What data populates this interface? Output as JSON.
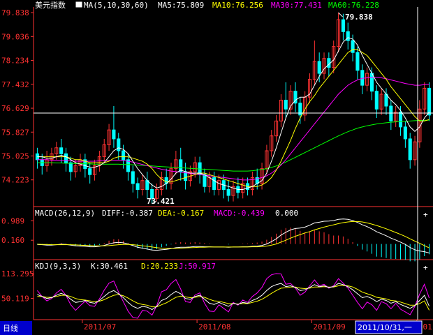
{
  "chart_data": {
    "type": "candlestick",
    "title": "美元指数",
    "colors": {
      "up": "#ff3232",
      "down": "#00ffff",
      "ma5": "#ffffff",
      "ma10": "#ffff00",
      "ma30": "#ff00ff",
      "ma60": "#00ff00",
      "grid": "#800000",
      "axis_text": "#ff3232",
      "price_text": "#ff5555"
    },
    "price_panel": {
      "ma_header": "MA(5,10,30,60)",
      "ma5_label": "MA5:75.809",
      "ma10_label": "MA10:76.256",
      "ma30_label": "MA30:77.431",
      "ma60_label": "MA60:76.228",
      "yticks": [
        "79.838",
        "79.036",
        "78.234",
        "77.432",
        "76.629",
        "75.827",
        "75.025",
        "74.223"
      ],
      "ylim": [
        73.42,
        79.84
      ],
      "high_label": "79.838",
      "low_label": "73.421",
      "cursor_price": 76.629
    },
    "macd_panel": {
      "header": "MACD(26,12,9)",
      "diff": "DIFF:-0.387",
      "dea": "DEA:-0.167",
      "macd": "MACD:-0.439",
      "extra": "0.000",
      "yticks": [
        "0.989",
        "0.160"
      ]
    },
    "kdj_panel": {
      "header": "KDJ(9,3,3)",
      "k": "K:30.461",
      "d": "D:20.233",
      "j": "J:50.917",
      "yticks": [
        "113.295",
        "50.119"
      ]
    },
    "x_axis": {
      "period_tab": "日线",
      "months": [
        "2011/07",
        "2011/08",
        "2011/09",
        "2011/1"
      ],
      "cursor_date": "2011/10/31,一"
    },
    "candles": [
      [
        75.1,
        74.9,
        75.3,
        74.6
      ],
      [
        74.9,
        74.7,
        75.1,
        74.4
      ],
      [
        74.7,
        74.9,
        75.2,
        74.5
      ],
      [
        74.9,
        75.1,
        75.3,
        74.7
      ],
      [
        75.1,
        75.3,
        75.5,
        74.9
      ],
      [
        75.3,
        75.1,
        75.6,
        74.8
      ],
      [
        75.1,
        74.8,
        75.3,
        74.5
      ],
      [
        74.8,
        74.5,
        75.0,
        74.2
      ],
      [
        74.5,
        74.7,
        74.9,
        74.3
      ],
      [
        74.7,
        74.9,
        75.1,
        74.5
      ],
      [
        74.9,
        74.6,
        75.1,
        74.3
      ],
      [
        74.6,
        74.4,
        74.8,
        74.1
      ],
      [
        74.4,
        74.7,
        74.9,
        74.2
      ],
      [
        74.7,
        75.0,
        75.2,
        74.5
      ],
      [
        75.0,
        75.4,
        75.6,
        74.8
      ],
      [
        75.4,
        75.9,
        76.1,
        75.2
      ],
      [
        75.9,
        75.6,
        76.7,
        75.3
      ],
      [
        75.6,
        75.2,
        75.8,
        74.9
      ],
      [
        75.2,
        74.9,
        75.4,
        74.6
      ],
      [
        74.9,
        74.5,
        75.1,
        74.2
      ],
      [
        74.5,
        74.1,
        74.7,
        73.8
      ],
      [
        74.1,
        73.9,
        74.3,
        73.6
      ],
      [
        73.9,
        74.2,
        74.4,
        73.7
      ],
      [
        74.2,
        73.9,
        74.5,
        73.6
      ],
      [
        73.9,
        73.6,
        74.1,
        73.42
      ],
      [
        73.6,
        73.9,
        74.1,
        73.5
      ],
      [
        73.9,
        74.3,
        74.5,
        73.7
      ],
      [
        74.3,
        74.1,
        74.6,
        73.9
      ],
      [
        74.1,
        74.6,
        74.8,
        73.9
      ],
      [
        74.6,
        74.9,
        75.2,
        74.4
      ],
      [
        74.9,
        74.5,
        75.3,
        74.2
      ],
      [
        74.5,
        74.2,
        74.8,
        73.9
      ],
      [
        74.2,
        74.5,
        74.7,
        74.0
      ],
      [
        74.5,
        74.8,
        75.0,
        74.3
      ],
      [
        74.8,
        74.4,
        75.0,
        74.1
      ],
      [
        74.4,
        74.0,
        74.6,
        73.8
      ],
      [
        74.0,
        74.3,
        74.5,
        73.8
      ],
      [
        74.3,
        73.9,
        74.5,
        73.7
      ],
      [
        73.9,
        74.2,
        74.4,
        73.7
      ],
      [
        74.2,
        73.9,
        74.4,
        73.6
      ],
      [
        73.9,
        73.7,
        74.2,
        73.5
      ],
      [
        73.7,
        74.0,
        74.2,
        73.5
      ],
      [
        74.0,
        73.8,
        74.3,
        73.6
      ],
      [
        73.8,
        74.1,
        74.3,
        73.6
      ],
      [
        74.1,
        73.9,
        74.3,
        73.7
      ],
      [
        73.9,
        74.3,
        74.5,
        73.7
      ],
      [
        74.3,
        74.1,
        74.6,
        73.9
      ],
      [
        74.1,
        74.6,
        74.8,
        73.9
      ],
      [
        74.6,
        75.2,
        75.4,
        74.4
      ],
      [
        75.2,
        75.7,
        75.9,
        75.0
      ],
      [
        75.7,
        76.2,
        76.4,
        75.5
      ],
      [
        76.2,
        76.9,
        77.1,
        76.0
      ],
      [
        76.9,
        76.6,
        77.5,
        76.3
      ],
      [
        76.6,
        77.2,
        77.4,
        76.4
      ],
      [
        77.2,
        76.8,
        77.5,
        76.5
      ],
      [
        76.8,
        76.4,
        77.0,
        76.1
      ],
      [
        76.4,
        77.0,
        77.2,
        76.2
      ],
      [
        77.0,
        77.6,
        77.8,
        76.8
      ],
      [
        77.6,
        78.2,
        78.9,
        77.4
      ],
      [
        78.2,
        77.8,
        78.5,
        77.5
      ],
      [
        77.8,
        78.3,
        78.5,
        77.6
      ],
      [
        78.3,
        78.0,
        78.5,
        77.7
      ],
      [
        78.0,
        78.7,
        78.9,
        77.8
      ],
      [
        78.7,
        79.6,
        79.838,
        78.5
      ],
      [
        79.6,
        79.2,
        79.8,
        78.9
      ],
      [
        79.2,
        78.9,
        79.5,
        78.6
      ],
      [
        78.9,
        78.5,
        79.1,
        78.2
      ],
      [
        78.5,
        77.9,
        78.7,
        77.6
      ],
      [
        77.9,
        77.4,
        78.1,
        77.1
      ],
      [
        77.4,
        77.8,
        78.0,
        77.2
      ],
      [
        77.8,
        77.2,
        78.0,
        76.9
      ],
      [
        77.2,
        76.6,
        77.4,
        76.3
      ],
      [
        76.6,
        77.1,
        77.3,
        76.4
      ],
      [
        77.1,
        76.7,
        77.3,
        76.4
      ],
      [
        76.7,
        76.2,
        76.9,
        75.9
      ],
      [
        76.2,
        76.5,
        76.7,
        76.0
      ],
      [
        76.5,
        76.0,
        76.7,
        75.7
      ],
      [
        76.0,
        75.6,
        76.2,
        75.3
      ],
      [
        75.6,
        74.9,
        75.8,
        74.6
      ],
      [
        74.9,
        75.5,
        75.7,
        74.7
      ],
      [
        75.5,
        76.6,
        76.9,
        75.3
      ],
      [
        76.6,
        77.3,
        77.5,
        76.4
      ],
      [
        77.3,
        76.4,
        77.5,
        76.2
      ]
    ],
    "ma5": [
      75.0,
      75.0,
      74.95,
      74.95,
      75.0,
      75.05,
      75.0,
      74.9,
      74.8,
      74.75,
      74.7,
      74.65,
      74.65,
      74.7,
      74.8,
      75.0,
      75.2,
      75.3,
      75.25,
      75.1,
      74.85,
      74.6,
      74.4,
      74.2,
      74.05,
      73.95,
      74.0,
      74.1,
      74.25,
      74.45,
      74.55,
      74.5,
      74.45,
      74.45,
      74.45,
      74.4,
      74.3,
      74.2,
      74.1,
      74.05,
      74.0,
      73.95,
      73.9,
      73.9,
      73.95,
      74.0,
      74.1,
      74.2,
      74.45,
      74.85,
      75.3,
      75.8,
      76.3,
      76.7,
      76.9,
      77.0,
      77.0,
      77.1,
      77.4,
      77.7,
      77.95,
      78.1,
      78.25,
      78.55,
      78.85,
      79.0,
      78.95,
      78.75,
      78.4,
      78.1,
      77.8,
      77.5,
      77.3,
      77.1,
      76.9,
      76.75,
      76.55,
      76.3,
      76.0,
      75.85,
      76.0,
      76.3,
      76.5
    ],
    "ma10": [
      75.0,
      75.0,
      75.0,
      75.0,
      75.0,
      75.0,
      75.0,
      74.95,
      74.9,
      74.9,
      74.85,
      74.8,
      74.8,
      74.8,
      74.8,
      74.85,
      74.95,
      75.0,
      75.0,
      75.0,
      74.95,
      74.9,
      74.85,
      74.75,
      74.6,
      74.4,
      74.25,
      74.15,
      74.15,
      74.2,
      74.25,
      74.3,
      74.35,
      74.4,
      74.45,
      74.45,
      74.4,
      74.35,
      74.3,
      74.25,
      74.2,
      74.15,
      74.1,
      74.05,
      74.0,
      74.0,
      74.0,
      74.05,
      74.15,
      74.3,
      74.55,
      74.85,
      75.2,
      75.55,
      75.95,
      76.3,
      76.6,
      76.85,
      77.05,
      77.3,
      77.5,
      77.7,
      77.9,
      78.1,
      78.3,
      78.5,
      78.6,
      78.6,
      78.5,
      78.4,
      78.2,
      78.0,
      77.8,
      77.6,
      77.35,
      77.15,
      76.95,
      76.75,
      76.55,
      76.35,
      76.2,
      76.2,
      76.25
    ],
    "ma30": [
      74.9,
      74.9,
      74.9,
      74.88,
      74.88,
      74.88,
      74.87,
      74.86,
      74.85,
      74.85,
      74.85,
      74.85,
      74.85,
      74.86,
      74.87,
      74.88,
      74.88,
      74.88,
      74.87,
      74.85,
      74.82,
      74.78,
      74.74,
      74.7,
      74.66,
      74.62,
      74.58,
      74.55,
      74.52,
      74.5,
      74.48,
      74.46,
      74.44,
      74.42,
      74.4,
      74.38,
      74.36,
      74.34,
      74.32,
      74.3,
      74.28,
      74.26,
      74.24,
      74.22,
      74.22,
      74.23,
      74.26,
      74.3,
      74.36,
      74.45,
      74.57,
      74.72,
      74.9,
      75.1,
      75.3,
      75.5,
      75.7,
      75.9,
      76.1,
      76.3,
      76.5,
      76.7,
      76.9,
      77.1,
      77.25,
      77.4,
      77.5,
      77.58,
      77.63,
      77.65,
      77.66,
      77.66,
      77.65,
      77.62,
      77.58,
      77.54,
      77.5,
      77.46,
      77.43,
      77.4,
      77.4,
      77.42,
      77.43
    ],
    "ma60": [
      74.8,
      74.8,
      74.8,
      74.8,
      74.79,
      74.79,
      74.78,
      74.78,
      74.77,
      74.77,
      74.76,
      74.76,
      74.75,
      74.75,
      74.75,
      74.75,
      74.75,
      74.75,
      74.74,
      74.74,
      74.73,
      74.72,
      74.71,
      74.7,
      74.69,
      74.68,
      74.67,
      74.66,
      74.65,
      74.64,
      74.63,
      74.62,
      74.61,
      74.6,
      74.59,
      74.58,
      74.57,
      74.56,
      74.55,
      74.54,
      74.53,
      74.52,
      74.52,
      74.52,
      74.52,
      74.53,
      74.55,
      74.57,
      74.6,
      74.64,
      74.69,
      74.75,
      74.82,
      74.9,
      74.98,
      75.06,
      75.14,
      75.22,
      75.3,
      75.38,
      75.46,
      75.54,
      75.62,
      75.7,
      75.77,
      75.84,
      75.9,
      75.96,
      76.0,
      76.04,
      76.07,
      76.1,
      76.12,
      76.14,
      76.16,
      76.17,
      76.18,
      76.19,
      76.2,
      76.21,
      76.22,
      76.225,
      76.228
    ],
    "macd_diff": [
      -0.02,
      -0.03,
      -0.05,
      -0.05,
      -0.03,
      -0.01,
      -0.02,
      -0.05,
      -0.08,
      -0.09,
      -0.1,
      -0.12,
      -0.12,
      -0.1,
      -0.06,
      0.0,
      0.05,
      0.07,
      0.05,
      0.0,
      -0.07,
      -0.14,
      -0.18,
      -0.22,
      -0.26,
      -0.27,
      -0.25,
      -0.23,
      -0.2,
      -0.16,
      -0.14,
      -0.14,
      -0.13,
      -0.11,
      -0.11,
      -0.12,
      -0.12,
      -0.13,
      -0.13,
      -0.13,
      -0.14,
      -0.13,
      -0.13,
      -0.12,
      -0.12,
      -0.1,
      -0.09,
      -0.06,
      0.0,
      0.1,
      0.22,
      0.38,
      0.5,
      0.6,
      0.66,
      0.68,
      0.72,
      0.8,
      0.9,
      0.93,
      0.97,
      0.98,
      1.0,
      1.05,
      1.07,
      1.05,
      1.0,
      0.92,
      0.82,
      0.74,
      0.64,
      0.52,
      0.44,
      0.35,
      0.25,
      0.17,
      0.08,
      -0.02,
      -0.15,
      -0.25,
      -0.3,
      -0.33,
      -0.387
    ],
    "macd_dea": [
      -0.01,
      -0.02,
      -0.02,
      -0.03,
      -0.03,
      -0.03,
      -0.03,
      -0.03,
      -0.04,
      -0.05,
      -0.06,
      -0.07,
      -0.08,
      -0.08,
      -0.08,
      -0.07,
      -0.05,
      -0.03,
      -0.02,
      -0.02,
      -0.03,
      -0.05,
      -0.08,
      -0.1,
      -0.13,
      -0.16,
      -0.18,
      -0.19,
      -0.19,
      -0.19,
      -0.18,
      -0.17,
      -0.16,
      -0.15,
      -0.14,
      -0.14,
      -0.13,
      -0.13,
      -0.13,
      -0.13,
      -0.13,
      -0.13,
      -0.13,
      -0.13,
      -0.13,
      -0.12,
      -0.12,
      -0.11,
      -0.09,
      -0.05,
      0.0,
      0.08,
      0.16,
      0.25,
      0.33,
      0.4,
      0.47,
      0.53,
      0.6,
      0.66,
      0.72,
      0.77,
      0.82,
      0.87,
      0.91,
      0.94,
      0.96,
      0.96,
      0.94,
      0.9,
      0.85,
      0.79,
      0.72,
      0.65,
      0.57,
      0.49,
      0.41,
      0.32,
      0.22,
      0.12,
      0.03,
      -0.07,
      -0.167
    ],
    "kdj_k": [
      60,
      55,
      50,
      52,
      58,
      63,
      58,
      48,
      40,
      42,
      45,
      40,
      38,
      45,
      55,
      65,
      70,
      62,
      52,
      40,
      30,
      25,
      30,
      28,
      22,
      30,
      45,
      50,
      60,
      68,
      62,
      50,
      48,
      55,
      58,
      48,
      38,
      35,
      40,
      35,
      30,
      38,
      35,
      40,
      38,
      45,
      50,
      58,
      70,
      80,
      85,
      88,
      80,
      82,
      78,
      70,
      72,
      78,
      85,
      80,
      82,
      78,
      80,
      88,
      85,
      80,
      72,
      62,
      52,
      55,
      50,
      42,
      48,
      45,
      38,
      42,
      35,
      30,
      25,
      32,
      45,
      58,
      30.461
    ],
    "kdj_d": [
      55,
      55,
      53,
      53,
      55,
      58,
      58,
      55,
      50,
      47,
      46,
      44,
      42,
      43,
      47,
      53,
      58,
      60,
      57,
      51,
      44,
      38,
      35,
      33,
      29,
      29,
      34,
      39,
      46,
      53,
      56,
      54,
      52,
      53,
      55,
      53,
      48,
      44,
      43,
      40,
      37,
      37,
      36,
      37,
      37,
      40,
      43,
      48,
      55,
      63,
      70,
      76,
      77,
      79,
      79,
      76,
      75,
      76,
      79,
      79,
      80,
      79,
      79,
      82,
      83,
      82,
      79,
      73,
      66,
      62,
      58,
      53,
      51,
      49,
      45,
      44,
      41,
      37,
      33,
      33,
      37,
      44,
      20.233
    ],
    "kdj_j": [
      70,
      55,
      44,
      50,
      64,
      73,
      58,
      34,
      20,
      32,
      43,
      32,
      30,
      49,
      71,
      89,
      94,
      66,
      42,
      18,
      2,
      0,
      20,
      18,
      8,
      32,
      67,
      72,
      88,
      98,
      74,
      42,
      40,
      59,
      64,
      38,
      18,
      17,
      34,
      25,
      16,
      40,
      33,
      46,
      40,
      55,
      64,
      78,
      100,
      110,
      113,
      112,
      86,
      88,
      76,
      58,
      66,
      82,
      97,
      82,
      86,
      76,
      82,
      100,
      89,
      76,
      58,
      40,
      24,
      41,
      34,
      20,
      42,
      37,
      24,
      38,
      23,
      16,
      9,
      30,
      61,
      86,
      50.917
    ]
  }
}
